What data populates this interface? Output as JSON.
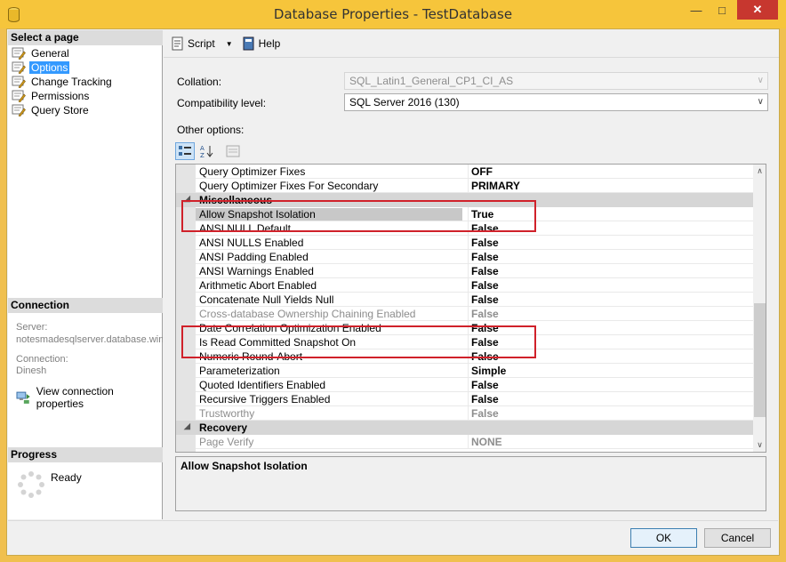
{
  "window": {
    "title": "Database Properties - TestDatabase"
  },
  "left": {
    "select_header": "Select a page",
    "pages": [
      "General",
      "Options",
      "Change Tracking",
      "Permissions",
      "Query Store"
    ],
    "connection_header": "Connection",
    "server_label": "Server:",
    "server_value": "notesmadesqlserver.database.wind",
    "connection_label": "Connection:",
    "connection_value": "Dinesh",
    "view_conn_link": "View connection properties",
    "progress_header": "Progress",
    "progress_status": "Ready"
  },
  "toolbar": {
    "script": "Script",
    "help": "Help"
  },
  "form": {
    "collation_label": "Collation:",
    "collation_value": "SQL_Latin1_General_CP1_CI_AS",
    "compat_label": "Compatibility level:",
    "compat_value": "SQL Server 2016 (130)",
    "other_options_label": "Other options:"
  },
  "grid": {
    "rows": [
      {
        "name": "Query Optimizer Fixes",
        "value": "OFF"
      },
      {
        "name": "Query Optimizer Fixes For Secondary",
        "value": "PRIMARY"
      }
    ],
    "misc_title": "Miscellaneous",
    "misc_rows": [
      {
        "name": "Allow Snapshot Isolation",
        "value": "True",
        "selected": true
      },
      {
        "name": "ANSI NULL Default",
        "value": "False"
      },
      {
        "name": "ANSI NULLS Enabled",
        "value": "False"
      },
      {
        "name": "ANSI Padding Enabled",
        "value": "False"
      },
      {
        "name": "ANSI Warnings Enabled",
        "value": "False"
      },
      {
        "name": "Arithmetic Abort Enabled",
        "value": "False"
      },
      {
        "name": "Concatenate Null Yields Null",
        "value": "False"
      },
      {
        "name": "Cross-database Ownership Chaining Enabled",
        "value": "False",
        "disabled": true
      },
      {
        "name": "Date Correlation Optimization Enabled",
        "value": "False"
      },
      {
        "name": "Is Read Committed Snapshot On",
        "value": "False"
      },
      {
        "name": "Numeric Round-Abort",
        "value": "False"
      },
      {
        "name": "Parameterization",
        "value": "Simple"
      },
      {
        "name": "Quoted Identifiers Enabled",
        "value": "False"
      },
      {
        "name": "Recursive Triggers Enabled",
        "value": "False"
      },
      {
        "name": "Trustworthy",
        "value": "False",
        "disabled": true
      }
    ],
    "recovery_title": "Recovery",
    "recovery_rows": [
      {
        "name": "Page Verify",
        "value": "NONE",
        "disabled": true
      }
    ]
  },
  "description": {
    "title": "Allow Snapshot Isolation"
  },
  "buttons": {
    "ok": "OK",
    "cancel": "Cancel"
  },
  "colors": {
    "highlight_box": "#d0212a",
    "selection": "#3399ff",
    "titlebar": "#f6c53b"
  }
}
